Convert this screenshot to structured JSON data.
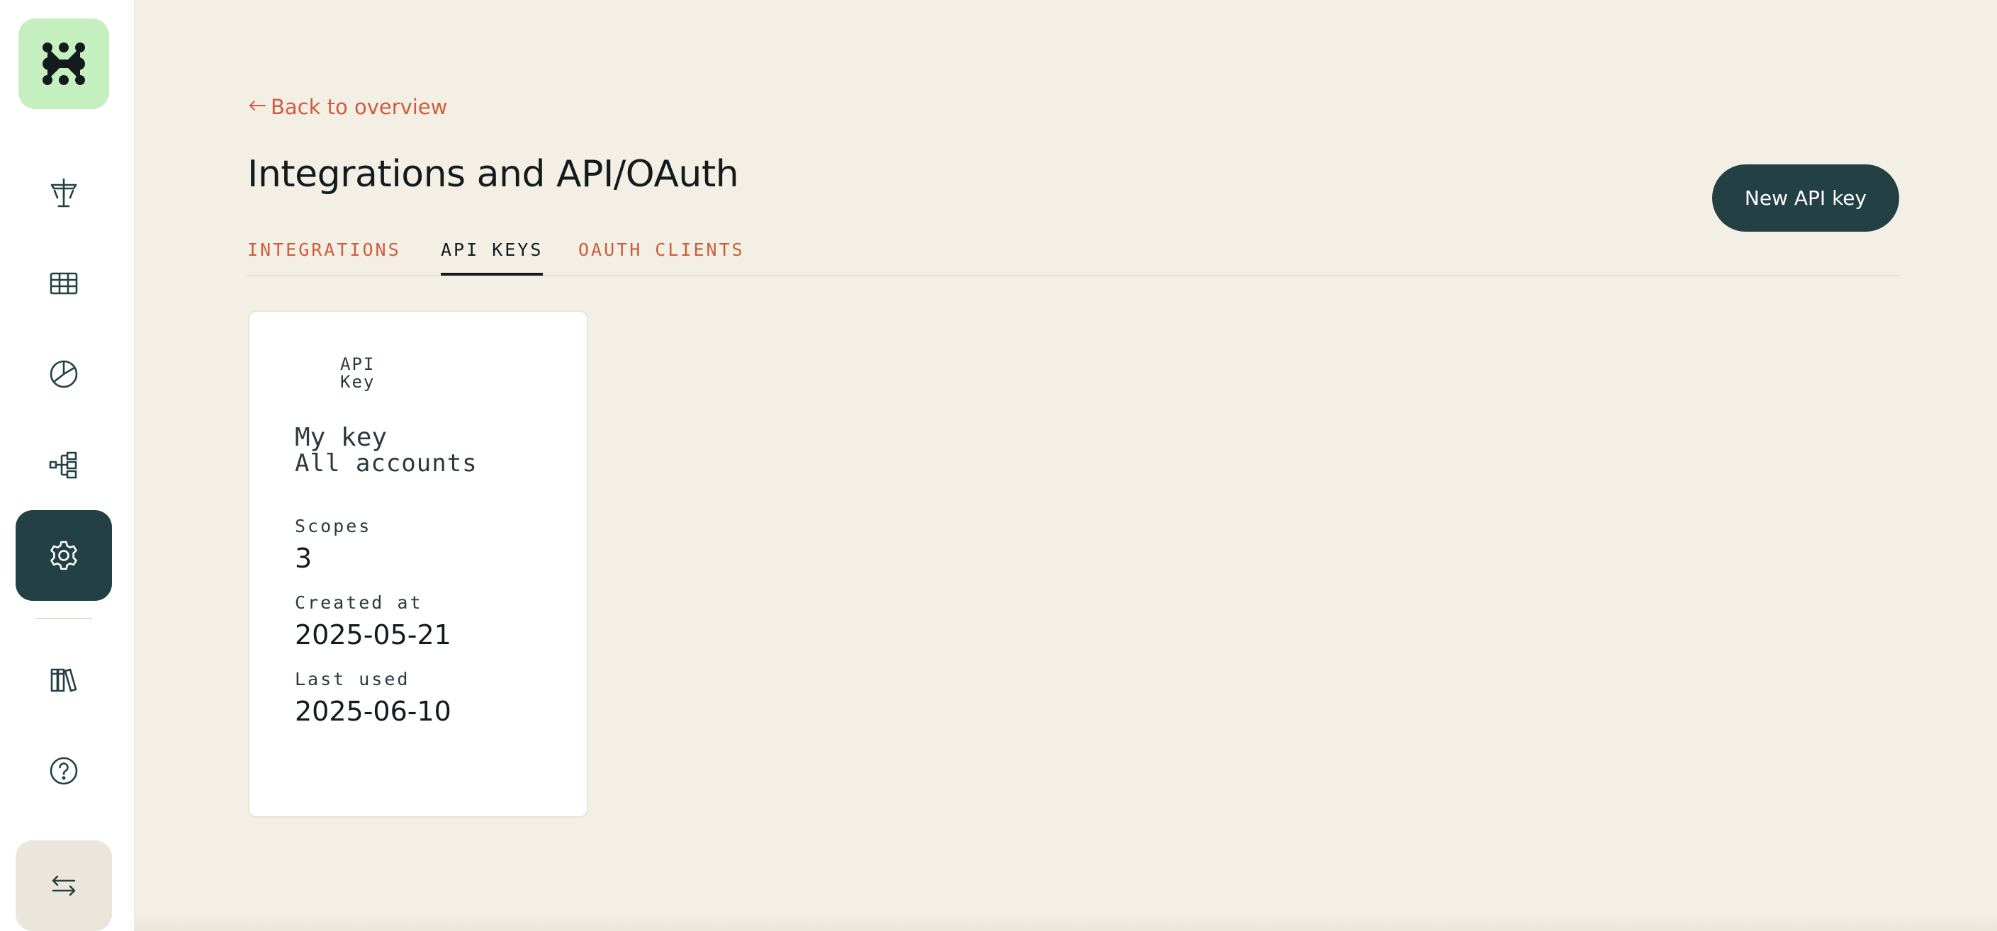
{
  "sidebar": {
    "logo_icon": "brand-logo-icon",
    "items": [
      {
        "name": "workspace",
        "icon": "crossroads-sign-icon"
      },
      {
        "name": "tables",
        "icon": "table-grid-icon"
      },
      {
        "name": "reports",
        "icon": "pie-chart-icon"
      },
      {
        "name": "automations",
        "icon": "flow-diagram-icon"
      },
      {
        "name": "settings",
        "icon": "gear-icon",
        "active": true
      },
      {
        "name": "library",
        "icon": "books-icon"
      },
      {
        "name": "help",
        "icon": "question-circle-icon"
      },
      {
        "name": "switch",
        "icon": "swap-arrows-icon"
      }
    ]
  },
  "header": {
    "back_label": "Back to overview",
    "title": "Integrations and API/OAuth",
    "new_button_label": "New API key"
  },
  "tabs": [
    {
      "label": "INTEGRATIONS",
      "active": false
    },
    {
      "label": "API KEYS",
      "active": true
    },
    {
      "label": "OAUTH CLIENTS",
      "active": false
    }
  ],
  "api_keys": [
    {
      "type_line1": "API",
      "type_line2": "Key",
      "name": "My key",
      "scope": "All accounts",
      "scopes_label": "Scopes",
      "scopes_count": "3",
      "created_label": "Created at",
      "created_value": "2025-05-21",
      "last_used_label": "Last used",
      "last_used_value": "2025-06-10"
    }
  ],
  "colors": {
    "background": "#f4efe5",
    "accent": "#cf5d3c",
    "primary_dark": "#234145",
    "logo_bg": "#c4f0c0"
  }
}
